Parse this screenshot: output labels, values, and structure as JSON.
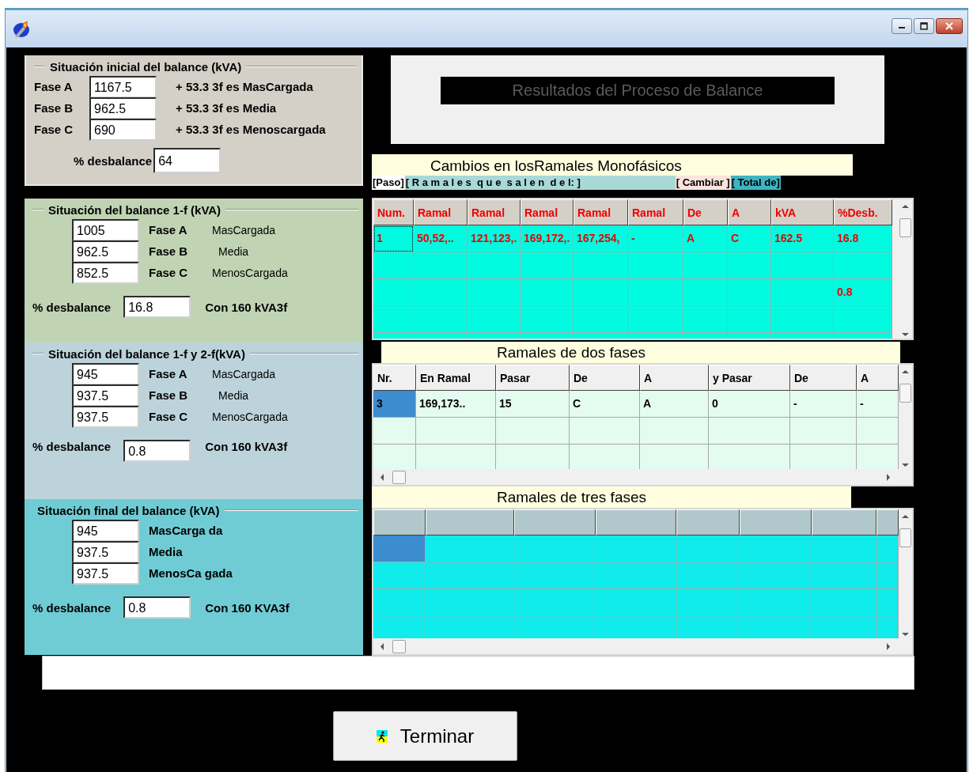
{
  "panels": [
    {
      "kind": "initial",
      "title": "Situación inicial del balance (kVA)",
      "rows": [
        {
          "phase": "Fase A",
          "value": "1167.5",
          "note": "+ 53.3 3f es MasCargada"
        },
        {
          "phase": "Fase B",
          "value": "962.5",
          "note": "+ 53.3 3f es Media"
        },
        {
          "phase": "Fase C",
          "value": "690",
          "note": "+ 53.3 3f es Menoscargada"
        }
      ],
      "imbalance_label": "% desbalance",
      "imbalance": "64"
    },
    {
      "kind": "step",
      "title": "Situación  del balance 1-f (kVA)",
      "rows": [
        {
          "value": "1005",
          "phase": "Fase A",
          "note": "MasCargada"
        },
        {
          "value": "962.5",
          "phase": "Fase B",
          "note": "Media"
        },
        {
          "value": "852.5",
          "phase": "Fase C",
          "note": "MenosCargada"
        }
      ],
      "imbalance_label": "% desbalance",
      "imbalance": "16.8",
      "capacity": "Con 160 kVA3f"
    },
    {
      "kind": "step",
      "title": "Situación del balance 1-f y 2-f(kVA)",
      "rows": [
        {
          "value": "945",
          "phase": "Fase A",
          "note": "MasCargada"
        },
        {
          "value": "937.5",
          "phase": "Fase B",
          "note": "Media"
        },
        {
          "value": "937.5",
          "phase": "Fase C",
          "note": "MenosCargada"
        }
      ],
      "imbalance_label": "% desbalance",
      "imbalance": "0.8",
      "capacity": "Con 160 kVA3f"
    },
    {
      "kind": "final",
      "title": "Situación final del balance  (kVA)",
      "rows": [
        {
          "value": "945",
          "note": "MasCarga da"
        },
        {
          "value": "937.5",
          "note": "Media"
        },
        {
          "value": "937.5",
          "note": "MenosCa gada"
        }
      ],
      "imbalance_label": "% desbalance",
      "imbalance": "0.8",
      "capacity": "Con 160 KVA3f"
    }
  ],
  "results_header": "Resultados del Proceso de Balance",
  "single_phase_changes": {
    "title": "Cambios en losRamales Monofásicos",
    "legend": [
      {
        "text": "[Paso]",
        "color": "#ffffff"
      },
      {
        "text": "[ R a m a l e s  q u e  s a l e n  d e l: ]",
        "color": "#a8d8d8"
      },
      {
        "text": "[ Cambiar ]",
        "color": "#fce4dc"
      },
      {
        "text": "[ Total de]",
        "color": "#40b4c4"
      }
    ],
    "columns": [
      "Num.",
      "Ramal",
      "Ramal",
      "Ramal",
      "Ramal",
      "Ramal",
      "De",
      "A",
      "kVA",
      "%Desb."
    ],
    "rows": [
      {
        "selected": true,
        "cells": [
          "1",
          "50,52,..",
          "121,123,.",
          "169,172,.",
          "167,254,",
          "-",
          "A",
          "C",
          "162.5",
          "16.8"
        ]
      },
      {
        "selected": false
      },
      {
        "selected": false,
        "cells": [
          null,
          null,
          null,
          null,
          null,
          null,
          null,
          null,
          null,
          "0.8"
        ]
      },
      {
        "selected": false
      },
      {
        "selected": false
      }
    ]
  },
  "two_phase_branches": {
    "title": "Ramales de dos fases",
    "columns": [
      "Nr.",
      "En Ramal",
      "Pasar",
      "De",
      "A",
      "y Pasar",
      "De",
      "A"
    ],
    "rows": [
      {
        "selected": true,
        "cells": [
          "3",
          "169,173..",
          "15",
          "C",
          "A",
          "0",
          "-",
          "-"
        ]
      },
      {
        "selected": false
      },
      {
        "selected": false
      }
    ]
  },
  "three_phase_branches": {
    "title": "Ramales de tres fases",
    "rows": [
      {
        "selected": true
      },
      {
        "selected": false
      },
      {
        "selected": false
      },
      {
        "selected": false
      }
    ]
  },
  "close_button": "Terminar"
}
